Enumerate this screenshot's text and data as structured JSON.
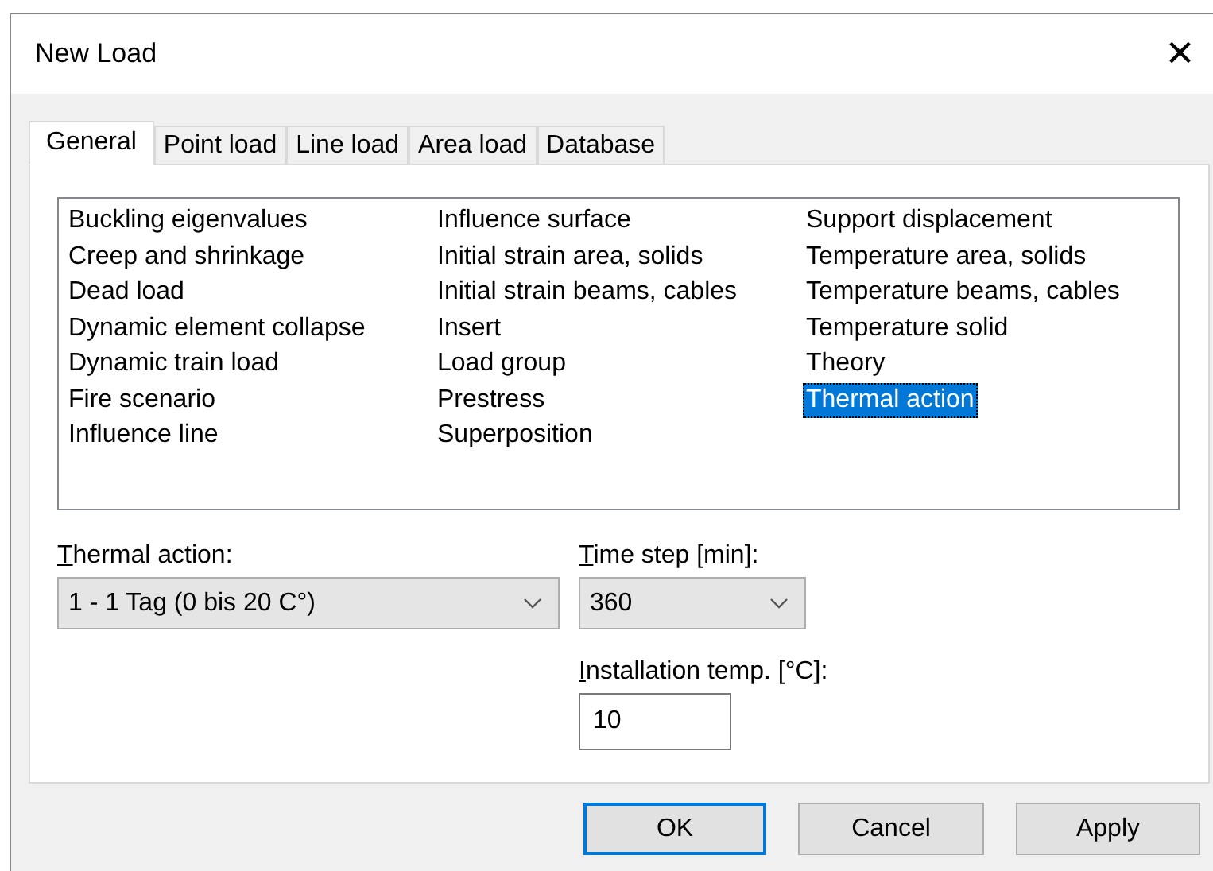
{
  "window": {
    "title": "New Load",
    "close": "×"
  },
  "tabs": [
    {
      "label": "General",
      "selected": true
    },
    {
      "label": "Point load",
      "selected": false
    },
    {
      "label": "Line load",
      "selected": false
    },
    {
      "label": "Area load",
      "selected": false
    },
    {
      "label": "Database",
      "selected": false
    }
  ],
  "load_types": {
    "columns": [
      [
        {
          "label": "Buckling eigenvalues",
          "selected": false
        },
        {
          "label": "Creep and shrinkage",
          "selected": false
        },
        {
          "label": "Dead load",
          "selected": false
        },
        {
          "label": "Dynamic element collapse",
          "selected": false
        },
        {
          "label": "Dynamic train load",
          "selected": false
        },
        {
          "label": "Fire scenario",
          "selected": false
        },
        {
          "label": "Influence line",
          "selected": false
        }
      ],
      [
        {
          "label": "Influence surface",
          "selected": false
        },
        {
          "label": "Initial strain area, solids",
          "selected": false
        },
        {
          "label": "Initial strain beams, cables",
          "selected": false
        },
        {
          "label": "Insert",
          "selected": false
        },
        {
          "label": "Load group",
          "selected": false
        },
        {
          "label": "Prestress",
          "selected": false
        },
        {
          "label": "Superposition",
          "selected": false
        }
      ],
      [
        {
          "label": "Support displacement",
          "selected": false
        },
        {
          "label": "Temperature area, solids",
          "selected": false
        },
        {
          "label": "Temperature beams, cables",
          "selected": false
        },
        {
          "label": "Temperature solid",
          "selected": false
        },
        {
          "label": "Theory",
          "selected": false
        },
        {
          "label": "Thermal action",
          "selected": true
        }
      ]
    ]
  },
  "thermal_action": {
    "label": "Thermal action:",
    "value": "1 - 1 Tag (0 bis 20 C°)"
  },
  "time_step": {
    "label": "Time step [min]:",
    "value": "360"
  },
  "installation_temp": {
    "label": "Installation temp. [°C]:",
    "value": "10"
  },
  "buttons": [
    {
      "label": "OK",
      "default": true
    },
    {
      "label": "Cancel",
      "default": false
    },
    {
      "label": "Apply",
      "default": false
    }
  ]
}
